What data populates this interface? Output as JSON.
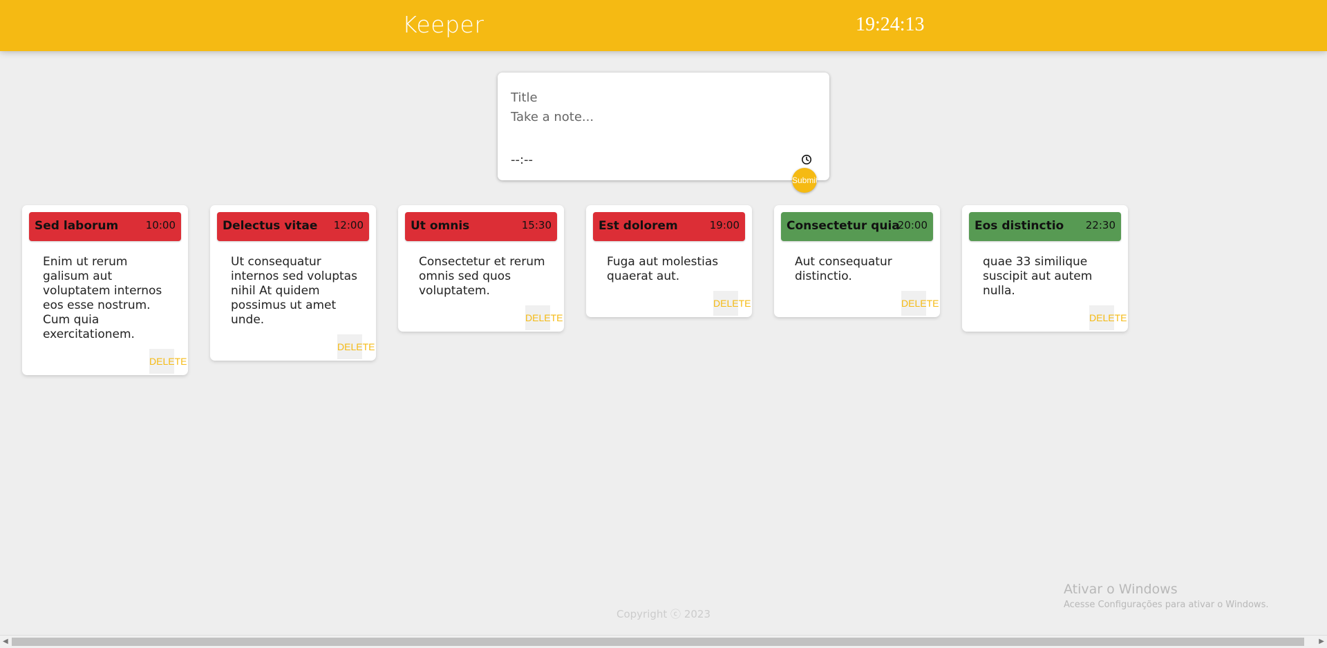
{
  "header": {
    "app_title": "Keeper",
    "clock": "19:24:13",
    "background_color": "#f5ba13"
  },
  "create_note": {
    "title_placeholder": "Title",
    "content_placeholder": "Take a note...",
    "time_value": "--:--",
    "time_icon": "clock-icon",
    "submit_label": "Submit"
  },
  "notes": [
    {
      "title": "Sed laborum",
      "time": "10:00",
      "color": "red",
      "content": "Enim ut rerum galisum aut voluptatem internos eos esse nostrum. Cum quia exercitationem.",
      "delete_label": "DELETE"
    },
    {
      "title": "Delectus vitae",
      "time": "12:00",
      "color": "red",
      "content": "Ut consequatur internos sed voluptas nihil At quidem possimus ut amet unde.",
      "delete_label": "DELETE"
    },
    {
      "title": "Ut omnis",
      "time": "15:30",
      "color": "red",
      "content": "Consectetur et rerum omnis sed quos voluptatem.",
      "delete_label": "DELETE"
    },
    {
      "title": "Est dolorem",
      "time": "19:00",
      "color": "red",
      "content": "Fuga aut molestias quaerat aut.",
      "delete_label": "DELETE"
    },
    {
      "title": "Consectetur quia",
      "time": "20:00",
      "color": "green",
      "content": "Aut consequatur distinctio.",
      "delete_label": "DELETE"
    },
    {
      "title": "Eos distinctio",
      "time": "22:30",
      "color": "green",
      "content": "quae 33 similique suscipit aut autem nulla.",
      "delete_label": "DELETE"
    }
  ],
  "colors": {
    "accent": "#f5ba13",
    "past_note": "#dc2e36",
    "upcoming_note": "#579a53"
  },
  "footer": {
    "copyright": "Copyright ⓒ 2023"
  },
  "watermark": {
    "title": "Ativar o Windows",
    "subtitle": "Acesse Configurações para ativar o Windows."
  }
}
